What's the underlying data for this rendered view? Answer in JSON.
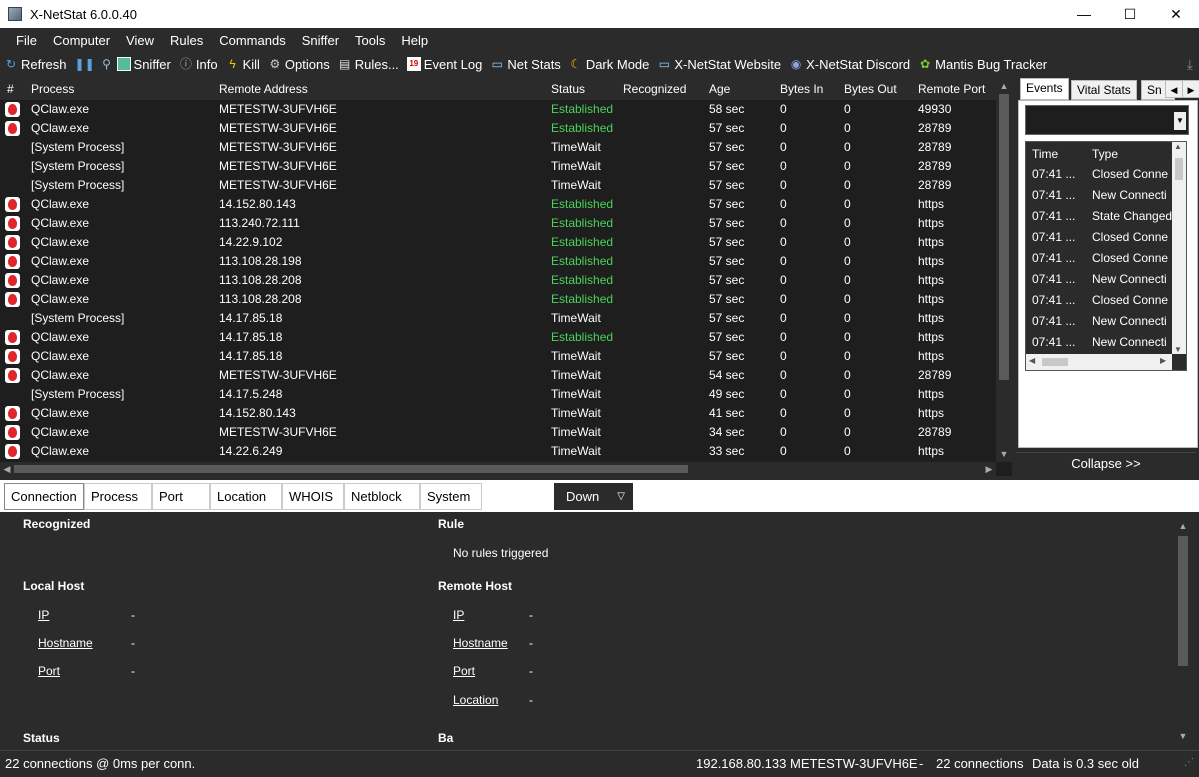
{
  "window": {
    "title": "X-NetStat 6.0.0.40"
  },
  "window_controls": {
    "minimize": "—",
    "maximize": "☐",
    "close": "✕"
  },
  "menu": [
    "File",
    "Computer",
    "View",
    "Rules",
    "Commands",
    "Sniffer",
    "Tools",
    "Help"
  ],
  "toolbar": {
    "refresh": "Refresh",
    "sniffer": "Sniffer",
    "info": "Info",
    "kill": "Kill",
    "options": "Options",
    "rules": "Rules...",
    "event_log": "Event Log",
    "net_stats": "Net Stats",
    "dark_mode": "Dark Mode",
    "website": "X-NetStat Website",
    "discord": "X-NetStat Discord",
    "mantis": "Mantis Bug Tracker"
  },
  "grid": {
    "columns": {
      "num": "#",
      "process": "Process",
      "remote_address": "Remote Address",
      "status": "Status",
      "recognized": "Recognized",
      "age": "Age",
      "bytes_in": "Bytes In",
      "bytes_out": "Bytes Out",
      "remote_port": "Remote Port"
    },
    "rows": [
      {
        "icon": true,
        "process": "QClaw.exe",
        "remote": "METESTW-3UFVH6E",
        "status": "Established",
        "age": "58 sec",
        "in": "0",
        "out": "0",
        "port": "49930"
      },
      {
        "icon": true,
        "process": "QClaw.exe",
        "remote": "METESTW-3UFVH6E",
        "status": "Established",
        "age": "57 sec",
        "in": "0",
        "out": "0",
        "port": "28789"
      },
      {
        "icon": false,
        "process": "[System Process]",
        "remote": "METESTW-3UFVH6E",
        "status": "TimeWait",
        "age": "57 sec",
        "in": "0",
        "out": "0",
        "port": "28789"
      },
      {
        "icon": false,
        "process": "[System Process]",
        "remote": "METESTW-3UFVH6E",
        "status": "TimeWait",
        "age": "57 sec",
        "in": "0",
        "out": "0",
        "port": "28789"
      },
      {
        "icon": false,
        "process": "[System Process]",
        "remote": "METESTW-3UFVH6E",
        "status": "TimeWait",
        "age": "57 sec",
        "in": "0",
        "out": "0",
        "port": "28789"
      },
      {
        "icon": true,
        "process": "QClaw.exe",
        "remote": "14.152.80.143",
        "status": "Established",
        "age": "57 sec",
        "in": "0",
        "out": "0",
        "port": "https"
      },
      {
        "icon": true,
        "process": "QClaw.exe",
        "remote": "113.240.72.111",
        "status": "Established",
        "age": "57 sec",
        "in": "0",
        "out": "0",
        "port": "https"
      },
      {
        "icon": true,
        "process": "QClaw.exe",
        "remote": "14.22.9.102",
        "status": "Established",
        "age": "57 sec",
        "in": "0",
        "out": "0",
        "port": "https"
      },
      {
        "icon": true,
        "process": "QClaw.exe",
        "remote": "113.108.28.198",
        "status": "Established",
        "age": "57 sec",
        "in": "0",
        "out": "0",
        "port": "https"
      },
      {
        "icon": true,
        "process": "QClaw.exe",
        "remote": "113.108.28.208",
        "status": "Established",
        "age": "57 sec",
        "in": "0",
        "out": "0",
        "port": "https"
      },
      {
        "icon": true,
        "process": "QClaw.exe",
        "remote": "113.108.28.208",
        "status": "Established",
        "age": "57 sec",
        "in": "0",
        "out": "0",
        "port": "https"
      },
      {
        "icon": false,
        "process": "[System Process]",
        "remote": "14.17.85.18",
        "status": "TimeWait",
        "age": "57 sec",
        "in": "0",
        "out": "0",
        "port": "https"
      },
      {
        "icon": true,
        "process": "QClaw.exe",
        "remote": "14.17.85.18",
        "status": "Established",
        "age": "57 sec",
        "in": "0",
        "out": "0",
        "port": "https"
      },
      {
        "icon": true,
        "process": "QClaw.exe",
        "remote": "14.17.85.18",
        "status": "TimeWait",
        "age": "57 sec",
        "in": "0",
        "out": "0",
        "port": "https"
      },
      {
        "icon": true,
        "process": "QClaw.exe",
        "remote": "METESTW-3UFVH6E",
        "status": "TimeWait",
        "age": "54 sec",
        "in": "0",
        "out": "0",
        "port": "28789"
      },
      {
        "icon": false,
        "process": "[System Process]",
        "remote": "14.17.5.248",
        "status": "TimeWait",
        "age": "49 sec",
        "in": "0",
        "out": "0",
        "port": "https"
      },
      {
        "icon": true,
        "process": "QClaw.exe",
        "remote": "14.152.80.143",
        "status": "TimeWait",
        "age": "41 sec",
        "in": "0",
        "out": "0",
        "port": "https"
      },
      {
        "icon": true,
        "process": "QClaw.exe",
        "remote": "METESTW-3UFVH6E",
        "status": "TimeWait",
        "age": "34 sec",
        "in": "0",
        "out": "0",
        "port": "28789"
      },
      {
        "icon": true,
        "process": "QClaw.exe",
        "remote": "14.22.6.249",
        "status": "TimeWait",
        "age": "33 sec",
        "in": "0",
        "out": "0",
        "port": "https"
      }
    ]
  },
  "right_panel": {
    "tabs": [
      "Events",
      "Vital Stats",
      "Sn"
    ],
    "events_columns": {
      "time": "Time",
      "type": "Type"
    },
    "events": [
      {
        "time": "07:41 ...",
        "type": "Closed Conne"
      },
      {
        "time": "07:41 ...",
        "type": "New Connecti"
      },
      {
        "time": "07:41 ...",
        "type": "State Changed"
      },
      {
        "time": "07:41 ...",
        "type": "Closed Conne"
      },
      {
        "time": "07:41 ...",
        "type": "Closed Conne"
      },
      {
        "time": "07:41 ...",
        "type": "New Connecti"
      },
      {
        "time": "07:41 ...",
        "type": "Closed Conne"
      },
      {
        "time": "07:41 ...",
        "type": "New Connecti"
      },
      {
        "time": "07:41 ...",
        "type": "New Connecti"
      }
    ],
    "collapse": "Collapse >>"
  },
  "detail_tabs": [
    "Connection",
    "Process",
    "Port",
    "Location",
    "WHOIS",
    "Netblock",
    "System"
  ],
  "down_button": "Down",
  "detail": {
    "recognized_head": "Recognized",
    "rule_head": "Rule",
    "rule_value": "No rules triggered",
    "local_head": "Local Host",
    "remote_head": "Remote Host",
    "local": [
      {
        "label": "IP",
        "value": "-"
      },
      {
        "label": "Hostname",
        "value": "-"
      },
      {
        "label": "Port",
        "value": "-"
      }
    ],
    "remote": [
      {
        "label": "IP",
        "value": "-"
      },
      {
        "label": "Hostname",
        "value": "-"
      },
      {
        "label": "Port",
        "value": "-"
      },
      {
        "label": "Location",
        "value": "-"
      }
    ],
    "status_head": "Status",
    "ba_head": "Ba"
  },
  "statusbar": {
    "left": "22 connections @ 0ms per conn.",
    "ip": "192.168.80.133",
    "host": "METESTW-3UFVH6E",
    "sep": "-",
    "count": "22 connections",
    "age": "Data is 0.3 sec old"
  }
}
